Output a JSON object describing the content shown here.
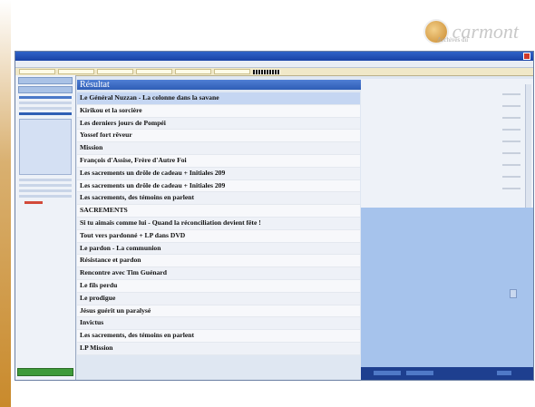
{
  "brand": {
    "small": "Archives du",
    "name": "carmont"
  },
  "panel": {
    "title": "Résultat",
    "items": [
      "Le Général Nuzzan - La colonne dans la savane",
      "Kirikou et la sorcière",
      "Les derniers jours de Pompéi",
      "Yossef fort rêveur",
      "Mission",
      "François d'Assise, Frère d'Autre Foi",
      "Les sacrements un drôle de cadeau + Initiales 209",
      "Les sacrements un drôle de cadeau + Initiales 209",
      "Les sacrements, des témoins en parlent",
      "SACREMENTS",
      "Si tu aimais comme lui - Quand la réconciliation devient fête !",
      "Tout vers pardonné + LP dans DVD",
      "Le pardon - La communion",
      "Résistance et pardon",
      "Rencontre avec Tim Guénard",
      "Le fils perdu",
      "Le prodigue",
      "Jésus guérit un paralysé",
      "Invictus",
      "Les sacrements, des témoins en parlent",
      "LP Mission"
    ]
  },
  "colors": {
    "accent": "#2e5db6",
    "slide_band": "#c98a2c"
  }
}
